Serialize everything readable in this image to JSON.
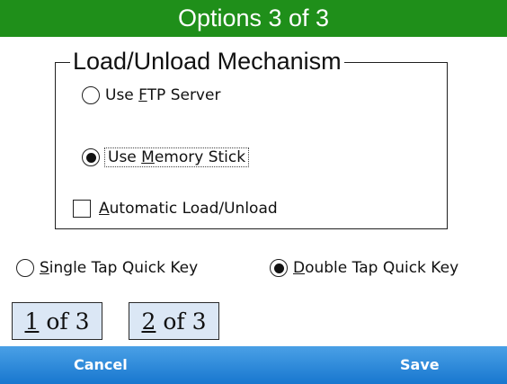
{
  "window": {
    "title": "Options 3 of 3"
  },
  "group": {
    "legend": "Load/Unload Mechanism",
    "ftp_server": {
      "label_pre": "Use ",
      "label_acc": "F",
      "label_post": "TP Server",
      "selected": false
    },
    "memory_stick": {
      "label_pre": "Use ",
      "label_acc": "M",
      "label_post": "emory Stick",
      "selected": true
    },
    "auto_load": {
      "label_pre": "",
      "label_acc": "A",
      "label_post": "utomatic Load/Unload",
      "checked": false
    }
  },
  "quick_key": {
    "single": {
      "label_acc": "S",
      "label_post": "ingle Tap Quick Key",
      "selected": false
    },
    "double": {
      "label_acc": "D",
      "label_post": "ouble Tap Quick Key",
      "selected": true
    }
  },
  "pages": [
    {
      "acc": "1",
      "rest": " of 3"
    },
    {
      "acc": "2",
      "rest": " of 3"
    }
  ],
  "softkeys": {
    "left": "Cancel",
    "right": "Save"
  },
  "colors": {
    "title_bar": "#1f8f1a",
    "softkey_bar": "#1877cf",
    "page_button": "#dbe7f5"
  }
}
